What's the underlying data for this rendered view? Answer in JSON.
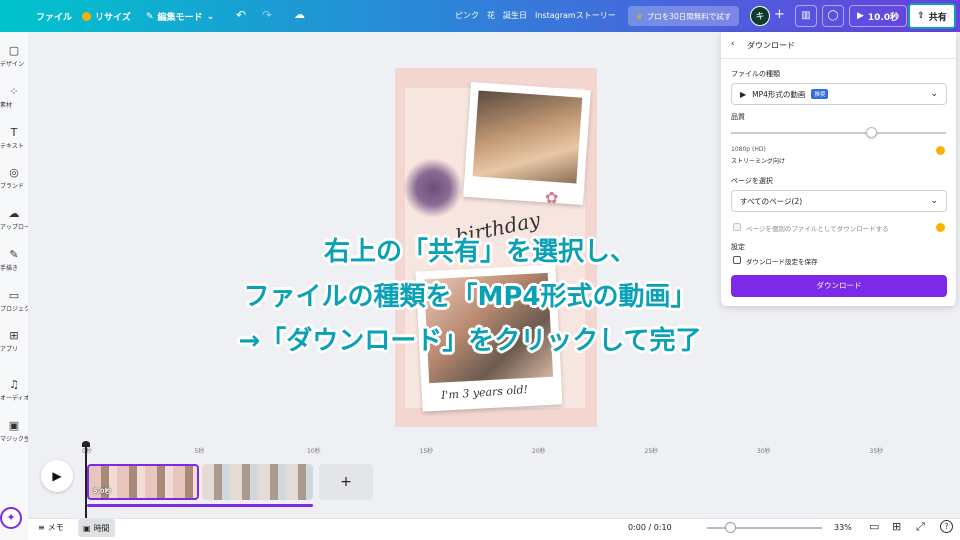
{
  "topbar": {
    "file": "ファイル",
    "resize": "リサイズ",
    "edit_mode": "編集モード",
    "doc_title": "ピンク　花　誕生日　Instagramストーリー",
    "pro_trial": "プロを30日間無料で試す",
    "avatar_letter": "キ",
    "play_time": "10.0秒",
    "share": "共有"
  },
  "sidebar": {
    "items": [
      {
        "label": "デザイン",
        "icon": "layout-icon"
      },
      {
        "label": "素材",
        "icon": "elements-icon"
      },
      {
        "label": "テキスト",
        "icon": "text-icon"
      },
      {
        "label": "ブランド",
        "icon": "brand-icon"
      },
      {
        "label": "アップロード",
        "icon": "upload-icon"
      },
      {
        "label": "手描き",
        "icon": "draw-icon"
      },
      {
        "label": "プロジェクト",
        "icon": "folder-icon"
      },
      {
        "label": "アプリ",
        "icon": "apps-icon"
      },
      {
        "label": "オーディオ",
        "icon": "audio-icon"
      },
      {
        "label": "マジック生成",
        "icon": "magic-icon"
      }
    ]
  },
  "design": {
    "birthday": "birthday",
    "years_old": "I'm 3 years old!"
  },
  "download_panel": {
    "title": "ダウンロード",
    "file_type_label": "ファイルの種類",
    "file_type_value": "MP4形式の動画",
    "file_type_badge": "推奨",
    "quality_label": "品質",
    "quality_value": "1080p (HD)",
    "quality_sub": "ストリーミング向け",
    "quality_level": 0.65,
    "pages_label": "ページを選択",
    "pages_value": "すべてのページ(2)",
    "separate_files": "ページを個別のファイルとしてダウンロードする",
    "settings_label": "設定",
    "save_settings": "ダウンロード設定を保存",
    "download_button": "ダウンロード"
  },
  "overlay": {
    "line1": "右上の「共有」を選択し、",
    "line2": "ファイルの種類を「MP4形式の動画」",
    "line3": "→「ダウンロード」をクリックして完了"
  },
  "timeline": {
    "ticks": [
      "0秒",
      "5秒",
      "10秒",
      "15秒",
      "20秒",
      "25秒",
      "30秒",
      "35秒"
    ],
    "clip1_duration": "5.0秒",
    "add": "+"
  },
  "bottombar": {
    "notes": "メモ",
    "timer": "時間",
    "time": "0:00 / 0:10",
    "zoom": "33%",
    "zoom_level": 0.2
  },
  "colors": {
    "accent_purple": "#7d2ae8",
    "teal_text": "#0aa1b6"
  }
}
